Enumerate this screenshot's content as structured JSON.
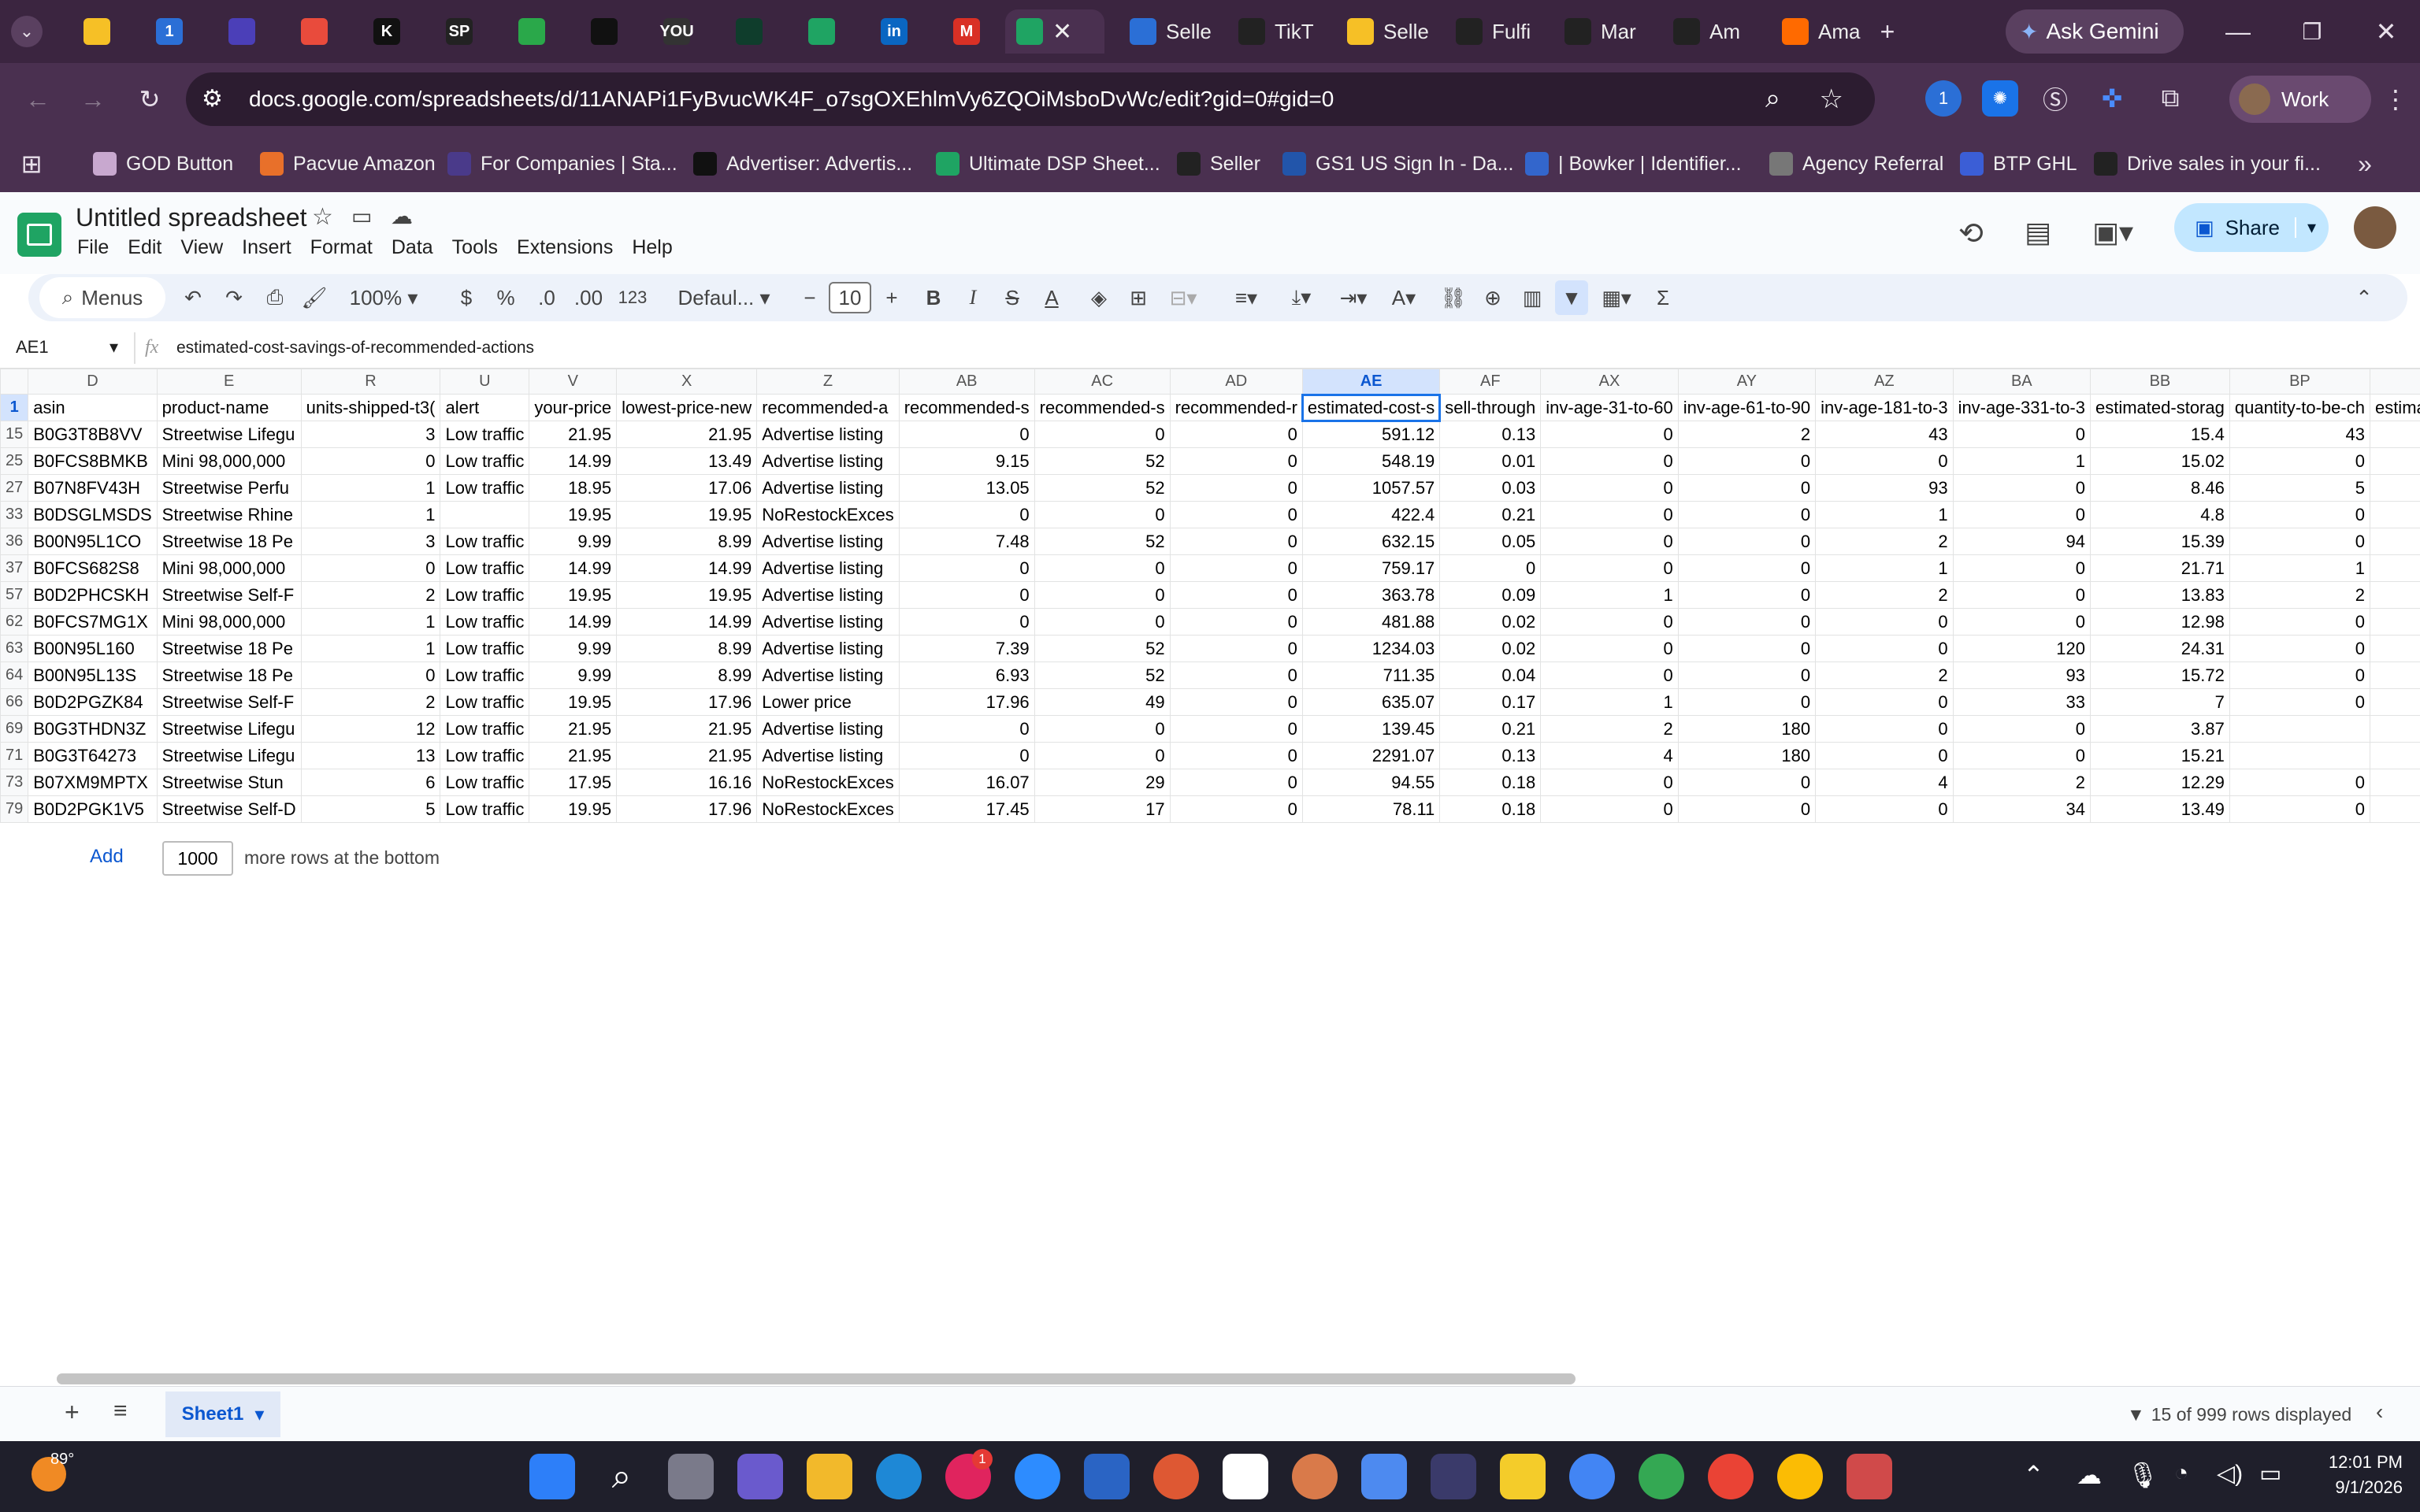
{
  "browser": {
    "tabs": [
      {
        "label": "",
        "color": "#f6c026"
      },
      {
        "label": "1",
        "color": "#2b6fd6"
      },
      {
        "label": "",
        "color": "#4b3fb8"
      },
      {
        "label": "",
        "color": "#e94b3c"
      },
      {
        "label": "K",
        "color": "#111111"
      },
      {
        "label": "SP",
        "color": "#222222"
      },
      {
        "label": "",
        "color": "#2aa84a"
      },
      {
        "label": "",
        "color": "#111111"
      },
      {
        "label": "YOU",
        "color": "#333333"
      },
      {
        "label": "",
        "color": "#0f3d2c"
      },
      {
        "label": "",
        "color": "#1fa463"
      },
      {
        "label": "in",
        "color": "#0a66c2"
      },
      {
        "label": "M",
        "color": "#d93025"
      }
    ],
    "active_tab_color": "#1fa463",
    "right_tabs": [
      {
        "label": "Selle",
        "color": "#2b6fd6"
      },
      {
        "label": "TikT",
        "color": "#222222"
      },
      {
        "label": "Selle",
        "color": "#f6c026"
      },
      {
        "label": "Fulfi",
        "color": "#222222"
      },
      {
        "label": "Mar",
        "color": "#222222"
      },
      {
        "label": "Am",
        "color": "#222222"
      },
      {
        "label": "Ama",
        "color": "#ff6a00"
      }
    ],
    "ask_gemini": "Ask Gemini",
    "url": "docs.google.com/spreadsheets/d/11ANAPi1FyBvucWK4F_o7sgOXEhlmVy6ZQOiMsboDvWc/edit?gid=0#gid=0",
    "profile_label": "Work",
    "bookmarks": [
      {
        "label": "GOD Button",
        "color": "#c8a8cf"
      },
      {
        "label": "Pacvue Amazon",
        "color": "#e8702a"
      },
      {
        "label": "For Companies | Sta...",
        "color": "#4a3a8a"
      },
      {
        "label": "Advertiser: Advertis...",
        "color": "#111111"
      },
      {
        "label": "Ultimate DSP Sheet...",
        "color": "#1fa463"
      },
      {
        "label": "Seller",
        "color": "#222222"
      },
      {
        "label": "GS1 US Sign In - Da...",
        "color": "#2255aa"
      },
      {
        "label": "| Bowker | Identifier...",
        "color": "#3366cc"
      },
      {
        "label": "Agency Referral",
        "color": "#777777"
      },
      {
        "label": "BTP GHL",
        "color": "#3b5ed6"
      },
      {
        "label": "Drive sales in your fi...",
        "color": "#222222"
      }
    ]
  },
  "docs": {
    "title": "Untitled spreadsheet",
    "menu": [
      "File",
      "Edit",
      "View",
      "Insert",
      "Format",
      "Data",
      "Tools",
      "Extensions",
      "Help"
    ],
    "share": "Share",
    "toolbar": {
      "menus": "Menus",
      "zoom": "100%",
      "currency": "$",
      "percent": "%",
      "dec_less": ".0",
      "dec_more": ".00",
      "number_format": "123",
      "font": "Defaul...",
      "font_size": "10",
      "bold": "B",
      "italic": "I",
      "strike": "S",
      "text_color": "A",
      "sum": "Σ"
    },
    "name_box": "AE1",
    "formula": "estimated-cost-savings-of-recommended-actions"
  },
  "sheet": {
    "columns": [
      "D",
      "E",
      "R",
      "U",
      "V",
      "X",
      "Z",
      "AB",
      "AC",
      "AD",
      "AE",
      "AF",
      "AX",
      "AY",
      "AZ",
      "BA",
      "BB",
      "BP",
      ""
    ],
    "selected_column": "AE",
    "headers": [
      "asin",
      "product-name",
      "units-shipped-t3(",
      "alert",
      "your-price",
      "lowest-price-new",
      "recommended-a",
      "recommended-s",
      "recommended-s",
      "recommended-r",
      "estimated-cost-s",
      "sell-through",
      "inv-age-31-to-60",
      "inv-age-61-to-90",
      "inv-age-181-to-3",
      "inv-age-331-to-3",
      "estimated-storag",
      "quantity-to-be-ch",
      "estima"
    ],
    "rows": [
      {
        "n": "15",
        "c": [
          "B0G3T8B8VV",
          "Streetwise Lifegu",
          "3",
          "Low traffic",
          "21.95",
          "21.95",
          "Advertise listing",
          "0",
          "0",
          "0",
          "591.12",
          "0.13",
          "0",
          "2",
          "43",
          "0",
          "15.4",
          "43",
          ""
        ]
      },
      {
        "n": "25",
        "c": [
          "B0FCS8BMKB",
          "Mini 98,000,000",
          "0",
          "Low traffic",
          "14.99",
          "13.49",
          "Advertise listing",
          "9.15",
          "52",
          "0",
          "548.19",
          "0.01",
          "0",
          "0",
          "0",
          "1",
          "15.02",
          "0",
          ""
        ]
      },
      {
        "n": "27",
        "c": [
          "B07N8FV43H",
          "Streetwise Perfu",
          "1",
          "Low traffic",
          "18.95",
          "17.06",
          "Advertise listing",
          "13.05",
          "52",
          "0",
          "1057.57",
          "0.03",
          "0",
          "0",
          "93",
          "0",
          "8.46",
          "5",
          ""
        ]
      },
      {
        "n": "33",
        "c": [
          "B0DSGLMSDS",
          "Streetwise Rhine",
          "1",
          "",
          "19.95",
          "19.95",
          "NoRestockExces",
          "0",
          "0",
          "0",
          "422.4",
          "0.21",
          "0",
          "0",
          "1",
          "0",
          "4.8",
          "0",
          ""
        ]
      },
      {
        "n": "36",
        "c": [
          "B00N95L1CO",
          "Streetwise 18 Pe",
          "3",
          "Low traffic",
          "9.99",
          "8.99",
          "Advertise listing",
          "7.48",
          "52",
          "0",
          "632.15",
          "0.05",
          "0",
          "0",
          "2",
          "94",
          "15.39",
          "0",
          ""
        ]
      },
      {
        "n": "37",
        "c": [
          "B0FCS682S8",
          "Mini 98,000,000",
          "0",
          "Low traffic",
          "14.99",
          "14.99",
          "Advertise listing",
          "0",
          "0",
          "0",
          "759.17",
          "0",
          "0",
          "0",
          "1",
          "0",
          "21.71",
          "1",
          ""
        ]
      },
      {
        "n": "57",
        "c": [
          "B0D2PHCSKH",
          "Streetwise Self-F",
          "2",
          "Low traffic",
          "19.95",
          "19.95",
          "Advertise listing",
          "0",
          "0",
          "0",
          "363.78",
          "0.09",
          "1",
          "0",
          "2",
          "0",
          "13.83",
          "2",
          ""
        ]
      },
      {
        "n": "62",
        "c": [
          "B0FCS7MG1X",
          "Mini 98,000,000",
          "1",
          "Low traffic",
          "14.99",
          "14.99",
          "Advertise listing",
          "0",
          "0",
          "0",
          "481.88",
          "0.02",
          "0",
          "0",
          "0",
          "0",
          "12.98",
          "0",
          ""
        ]
      },
      {
        "n": "63",
        "c": [
          "B00N95L160",
          "Streetwise 18 Pe",
          "1",
          "Low traffic",
          "9.99",
          "8.99",
          "Advertise listing",
          "7.39",
          "52",
          "0",
          "1234.03",
          "0.02",
          "0",
          "0",
          "0",
          "120",
          "24.31",
          "0",
          ""
        ]
      },
      {
        "n": "64",
        "c": [
          "B00N95L13S",
          "Streetwise 18 Pe",
          "0",
          "Low traffic",
          "9.99",
          "8.99",
          "Advertise listing",
          "6.93",
          "52",
          "0",
          "711.35",
          "0.04",
          "0",
          "0",
          "2",
          "93",
          "15.72",
          "0",
          ""
        ]
      },
      {
        "n": "66",
        "c": [
          "B0D2PGZK84",
          "Streetwise Self-F",
          "2",
          "Low traffic",
          "19.95",
          "17.96",
          "Lower price",
          "17.96",
          "49",
          "0",
          "635.07",
          "0.17",
          "1",
          "0",
          "0",
          "33",
          "7",
          "0",
          ""
        ]
      },
      {
        "n": "69",
        "c": [
          "B0G3THDN3Z",
          "Streetwise Lifegu",
          "12",
          "Low traffic",
          "21.95",
          "21.95",
          "Advertise listing",
          "0",
          "0",
          "0",
          "139.45",
          "0.21",
          "2",
          "180",
          "0",
          "0",
          "3.87",
          "",
          ""
        ]
      },
      {
        "n": "71",
        "c": [
          "B0G3T64273",
          "Streetwise Lifegu",
          "13",
          "Low traffic",
          "21.95",
          "21.95",
          "Advertise listing",
          "0",
          "0",
          "0",
          "2291.07",
          "0.13",
          "4",
          "180",
          "0",
          "0",
          "15.21",
          "",
          ""
        ]
      },
      {
        "n": "73",
        "c": [
          "B07XM9MPTX",
          "Streetwise Stun",
          "6",
          "Low traffic",
          "17.95",
          "16.16",
          "NoRestockExces",
          "16.07",
          "29",
          "0",
          "94.55",
          "0.18",
          "0",
          "0",
          "4",
          "2",
          "12.29",
          "0",
          ""
        ]
      },
      {
        "n": "79",
        "c": [
          "B0D2PGK1V5",
          "Streetwise Self-D",
          "5",
          "Low traffic",
          "19.95",
          "17.96",
          "NoRestockExces",
          "17.45",
          "17",
          "0",
          "78.11",
          "0.18",
          "0",
          "0",
          "0",
          "34",
          "13.49",
          "0",
          ""
        ]
      }
    ],
    "add_label": "Add",
    "add_count": "1000",
    "add_suffix": "more rows at the bottom",
    "sheet_tab": "Sheet1",
    "rows_displayed": "15 of 999 rows displayed"
  },
  "taskbar": {
    "weather": "89°",
    "time": "12:01 PM",
    "date": "9/1/2026",
    "badge_count": "1"
  }
}
